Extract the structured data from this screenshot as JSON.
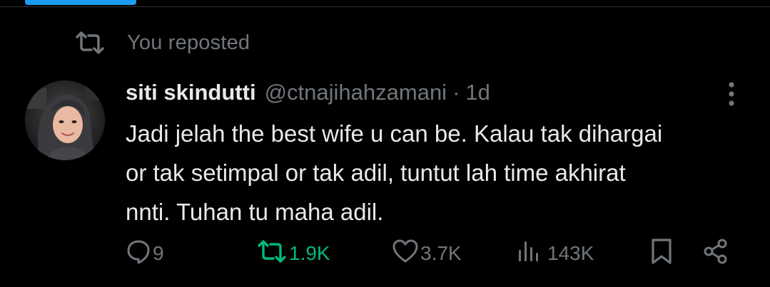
{
  "repost_banner": {
    "text": "You reposted",
    "icon": "repost-icon"
  },
  "tweet": {
    "display_name": "siti skindutti",
    "handle": "@ctnajihahzamani",
    "separator": "·",
    "time": "1d",
    "text": "Jadi jelah the best wife u can be. Kalau tak dihargai\nor tak setimpal or tak adil, tuntut lah time akhirat\nnnti. Tuhan tu maha adil."
  },
  "actions": {
    "reply_count": "9",
    "repost_count": "1.9K",
    "like_count": "3.7K",
    "view_count": "143K"
  },
  "colors": {
    "background": "#000000",
    "text_primary": "#e7e9ea",
    "text_secondary": "#71767b",
    "repost_green": "#00ba7c",
    "accent_blue": "#1d9bf0"
  }
}
